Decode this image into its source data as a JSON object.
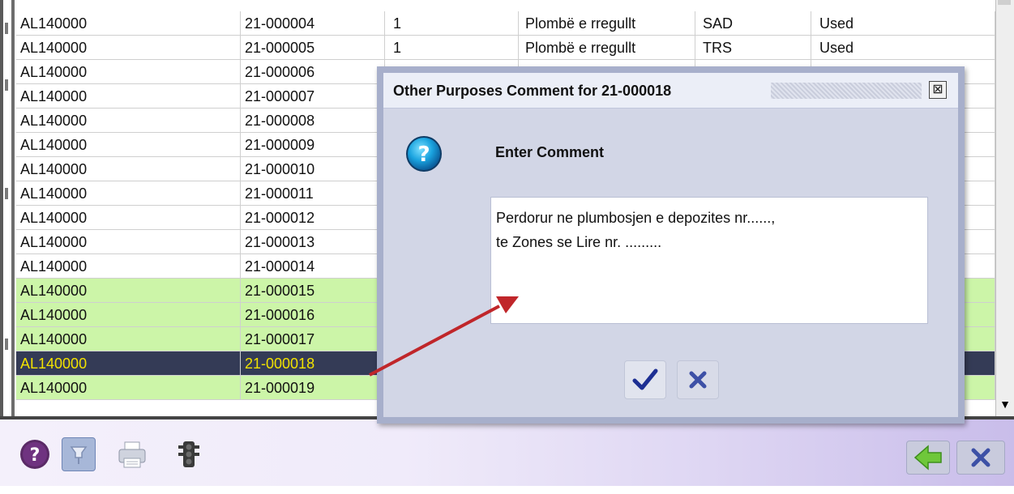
{
  "table": {
    "rows": [
      {
        "code": "AL140000",
        "number": "21-000004",
        "qty": "1",
        "type": "Plombë e rregullt",
        "doc": "SAD",
        "status": "Used",
        "highlight": "none"
      },
      {
        "code": "AL140000",
        "number": "21-000005",
        "qty": "1",
        "type": "Plombë e rregullt",
        "doc": "TRS",
        "status": "Used",
        "highlight": "none"
      },
      {
        "code": "AL140000",
        "number": "21-000006",
        "qty": "",
        "type": "",
        "doc": "",
        "status": "",
        "highlight": "none"
      },
      {
        "code": "AL140000",
        "number": "21-000007",
        "qty": "",
        "type": "",
        "doc": "",
        "status": "",
        "highlight": "none"
      },
      {
        "code": "AL140000",
        "number": "21-000008",
        "qty": "",
        "type": "",
        "doc": "",
        "status": "",
        "highlight": "none"
      },
      {
        "code": "AL140000",
        "number": "21-000009",
        "qty": "",
        "type": "",
        "doc": "",
        "status": "",
        "highlight": "none"
      },
      {
        "code": "AL140000",
        "number": "21-000010",
        "qty": "",
        "type": "",
        "doc": "",
        "status": "",
        "highlight": "none"
      },
      {
        "code": "AL140000",
        "number": "21-000011",
        "qty": "",
        "type": "",
        "doc": "",
        "status": "",
        "highlight": "none"
      },
      {
        "code": "AL140000",
        "number": "21-000012",
        "qty": "",
        "type": "",
        "doc": "",
        "status": "",
        "highlight": "none"
      },
      {
        "code": "AL140000",
        "number": "21-000013",
        "qty": "",
        "type": "",
        "doc": "",
        "status": "",
        "highlight": "none"
      },
      {
        "code": "AL140000",
        "number": "21-000014",
        "qty": "",
        "type": "",
        "doc": "",
        "status": "",
        "highlight": "none"
      },
      {
        "code": "AL140000",
        "number": "21-000015",
        "qty": "",
        "type": "",
        "doc": "",
        "status": "",
        "highlight": "green"
      },
      {
        "code": "AL140000",
        "number": "21-000016",
        "qty": "",
        "type": "",
        "doc": "",
        "status": "",
        "highlight": "green"
      },
      {
        "code": "AL140000",
        "number": "21-000017",
        "qty": "",
        "type": "",
        "doc": "",
        "status": "",
        "highlight": "green"
      },
      {
        "code": "AL140000",
        "number": "21-000018",
        "qty": "",
        "type": "",
        "doc": "",
        "status": "",
        "highlight": "selected"
      },
      {
        "code": "AL140000",
        "number": "21-000019",
        "qty": "",
        "type": "",
        "doc": "",
        "status": "",
        "highlight": "green"
      }
    ]
  },
  "dialog": {
    "title": "Other Purposes Comment for 21-000018",
    "heading": "Enter Comment",
    "comment": "Perdorur ne plumbosjen e depozites nr......,\nte Zones se Lire nr. .........",
    "icon": "question-icon",
    "ok_icon": "checkmark-icon",
    "cancel_icon": "x-icon",
    "close_icon": "close-icon"
  },
  "toolbar": {
    "icons": [
      "help-icon",
      "pin-icon",
      "print-icon",
      "traffic-light-icon",
      "back-arrow-icon",
      "close-icon"
    ]
  },
  "colors": {
    "row_green": "#ccf5a8",
    "row_selected_bg": "#343b56",
    "row_selected_text": "#f2e200",
    "dialog_bg": "#d2d6e6",
    "arrow": "#c0262a"
  }
}
